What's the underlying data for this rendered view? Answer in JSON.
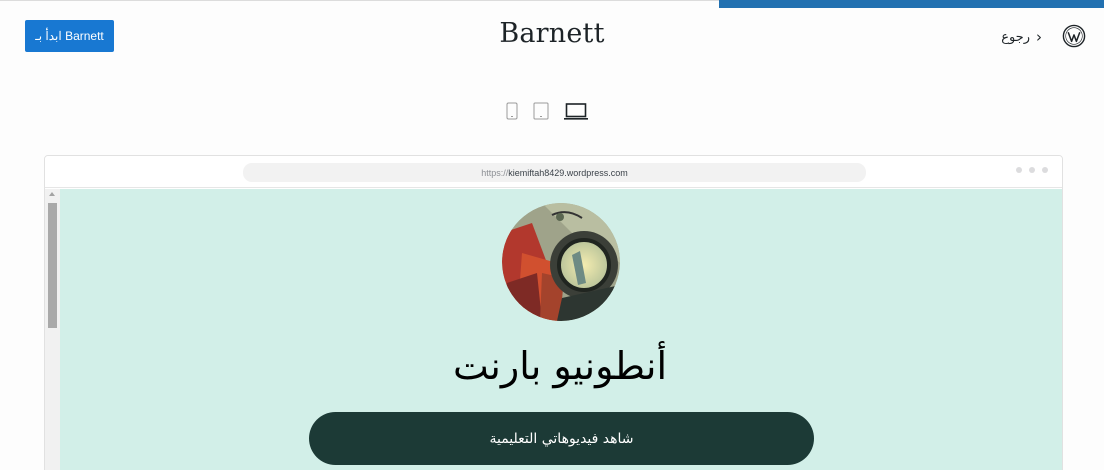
{
  "header": {
    "start_button_label": "ابدأ بـ Barnett",
    "theme_title": "Barnett",
    "back_label": "رجوع",
    "colors": {
      "accent": "#2271b1",
      "button": "#1878d2"
    }
  },
  "device_switcher": {
    "items": [
      {
        "name": "mobile",
        "icon": "phone-icon",
        "selected": false
      },
      {
        "name": "tablet",
        "icon": "tablet-icon",
        "selected": false
      },
      {
        "name": "desktop",
        "icon": "laptop-icon",
        "selected": true
      }
    ]
  },
  "browser": {
    "url_protocol": "https://",
    "url_host": "kiemiftah8429.wordpress.com"
  },
  "preview": {
    "background": "#d2efe8",
    "site_name": "أنطونيو بارنت",
    "cta_label": "شاهد فيديوهاتي التعليمية",
    "cta_color": "#1c3a36"
  }
}
